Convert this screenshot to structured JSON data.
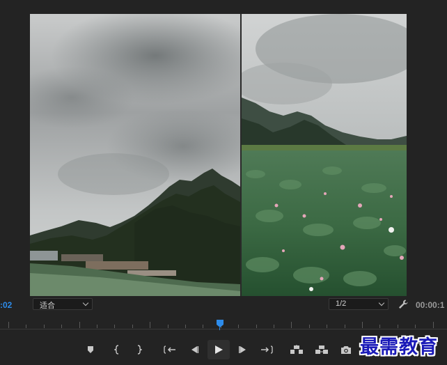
{
  "viewer": {
    "timecode_current": ":02",
    "timecode_duration": "00:00:1",
    "fit_dropdown": "适合",
    "resolution_dropdown": "1/2",
    "playhead_position_fraction": 0.49
  },
  "transport": {
    "buttons": [
      {
        "name": "add-marker-button",
        "icon": "marker-icon"
      },
      {
        "name": "mark-in-button",
        "icon": "mark-in-icon"
      },
      {
        "name": "mark-out-button",
        "icon": "mark-out-icon"
      },
      {
        "name": "go-to-in-button",
        "icon": "go-to-in-icon"
      },
      {
        "name": "step-back-button",
        "icon": "step-back-icon"
      },
      {
        "name": "play-button",
        "icon": "play-icon"
      },
      {
        "name": "step-forward-button",
        "icon": "step-forward-icon"
      },
      {
        "name": "go-to-out-button",
        "icon": "go-to-out-icon"
      },
      {
        "name": "lift-button",
        "icon": "lift-icon"
      },
      {
        "name": "extract-button",
        "icon": "extract-icon"
      },
      {
        "name": "export-frame-button",
        "icon": "camera-icon"
      }
    ]
  },
  "watermark": "最需教育",
  "colors": {
    "accent": "#2d8ceb",
    "background": "#232323",
    "watermark": "#1a1ab8"
  }
}
